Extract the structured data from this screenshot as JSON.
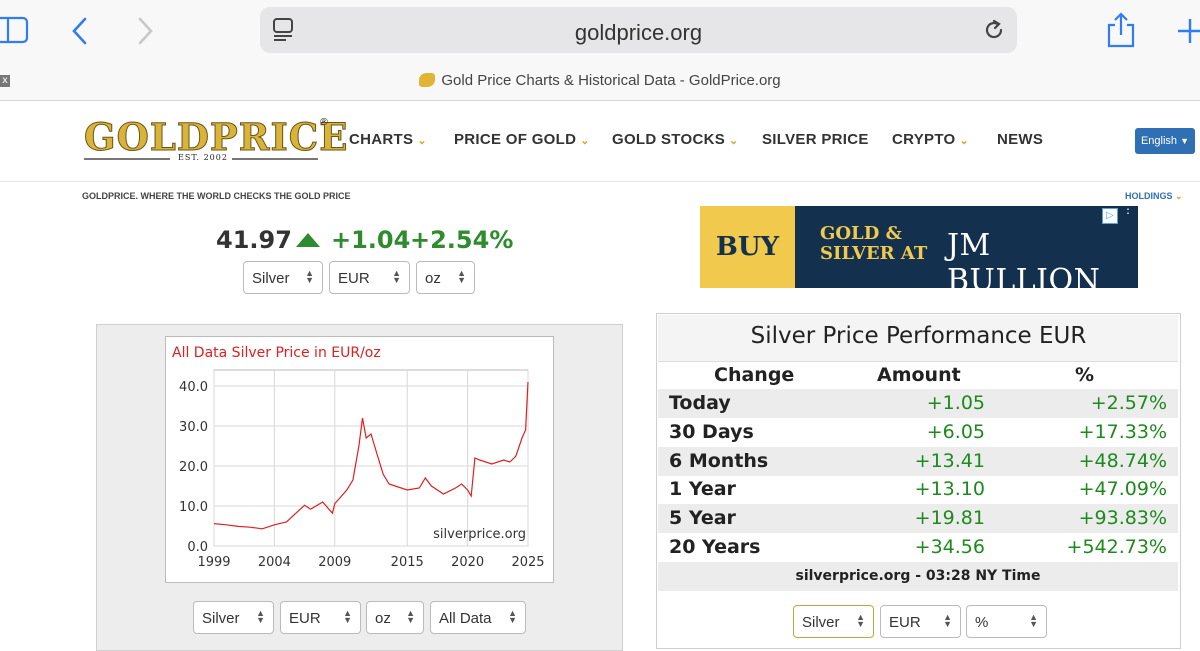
{
  "browser": {
    "url": "goldprice.org",
    "tab_title": "Gold Price Charts & Historical Data - GoldPrice.org",
    "tab_close": "x"
  },
  "site": {
    "logo_word": "GOLDPRICE",
    "logo_reg": "®",
    "logo_est": "EST. 2002",
    "nav": [
      {
        "label": "CHARTS",
        "dropdown": true
      },
      {
        "label": "PRICE OF GOLD",
        "dropdown": true
      },
      {
        "label": "GOLD STOCKS",
        "dropdown": true
      },
      {
        "label": "SILVER PRICE",
        "dropdown": false
      },
      {
        "label": "CRYPTO",
        "dropdown": true
      },
      {
        "label": "NEWS",
        "dropdown": false
      }
    ],
    "language": "English",
    "tagline": "GOLDPRICE. WHERE THE WORLD CHECKS THE GOLD PRICE",
    "holdings": "HOLDINGS"
  },
  "price": {
    "value": "41.97",
    "change": "+1.04",
    "change_pct": "+2.54%",
    "up_color": "#2e8b2e",
    "selectors": [
      "Silver",
      "EUR",
      "oz"
    ]
  },
  "ad": {
    "buy": "BUY",
    "line1": "GOLD &",
    "line2": "SILVER AT",
    "brand": "JM BULLION"
  },
  "chart_selectors": [
    "Silver",
    "EUR",
    "oz",
    "All Data"
  ],
  "chart_data": {
    "type": "line",
    "title": "All Data Silver Price in EUR/oz",
    "watermark": "silverprice.org",
    "x_ticks": [
      "1999",
      "2004",
      "2009",
      "2015",
      "2020",
      "2025"
    ],
    "y_ticks": [
      "0.0",
      "10.0",
      "20.0",
      "30.0",
      "40.0"
    ],
    "xlim": [
      1999,
      2025
    ],
    "ylim": [
      0,
      44
    ],
    "grid": true,
    "line_color": "#e02020",
    "series": [
      {
        "x": [
          1999,
          2000,
          2001,
          2002,
          2003,
          2004,
          2005,
          2006,
          2006.5,
          2007,
          2008,
          2008.8,
          2009,
          2010,
          2010.5,
          2011,
          2011.3,
          2011.6,
          2012,
          2012.5,
          2013,
          2013.5,
          2014,
          2015,
          2016,
          2016.5,
          2017,
          2018,
          2019,
          2019.5,
          2020,
          2020.3,
          2020.6,
          2021,
          2022,
          2023,
          2023.5,
          2024,
          2024.5,
          2024.8,
          2025
        ],
        "y": [
          5.6,
          5.3,
          4.9,
          4.7,
          4.3,
          5.3,
          6.0,
          8.8,
          10.2,
          9.2,
          11.0,
          8.2,
          10.6,
          14.0,
          16.5,
          25.0,
          32.0,
          27.0,
          28.0,
          23.0,
          18.0,
          15.5,
          15.0,
          14.0,
          14.5,
          17.0,
          15.0,
          13.0,
          14.5,
          15.5,
          14.0,
          12.5,
          22.0,
          21.5,
          20.5,
          21.5,
          21.0,
          22.5,
          27.0,
          29.0,
          41.0
        ]
      }
    ]
  },
  "performance": {
    "title": "Silver Price Performance EUR",
    "headers": [
      "Change",
      "Amount",
      "%"
    ],
    "rows": [
      {
        "label": "Today",
        "amount": "+1.05",
        "pct": "+2.57%"
      },
      {
        "label": "30 Days",
        "amount": "+6.05",
        "pct": "+17.33%"
      },
      {
        "label": "6 Months",
        "amount": "+13.41",
        "pct": "+48.74%"
      },
      {
        "label": "1 Year",
        "amount": "+13.10",
        "pct": "+47.09%"
      },
      {
        "label": "5 Year",
        "amount": "+19.81",
        "pct": "+93.83%"
      },
      {
        "label": "20 Years",
        "amount": "+34.56",
        "pct": "+542.73%"
      }
    ],
    "footer": "silverprice.org - 03:28 NY Time",
    "selectors": [
      "Silver",
      "EUR",
      "%"
    ]
  }
}
